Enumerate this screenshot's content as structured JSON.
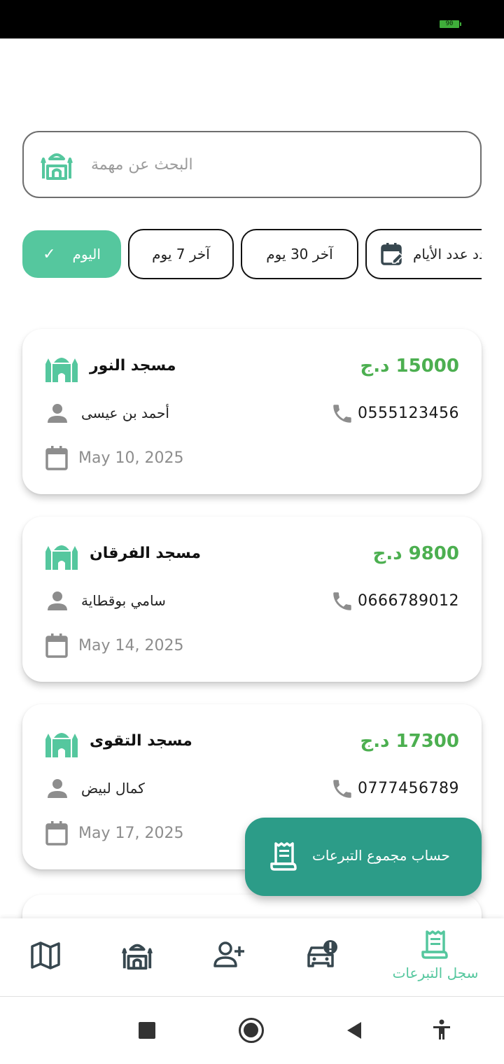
{
  "status_bar": {
    "battery": "90"
  },
  "search": {
    "placeholder": "البحث عن مهمة",
    "icon": "mosque-icon"
  },
  "filters": [
    {
      "label": "اليوم",
      "selected": true
    },
    {
      "label": "آخر 7 يوم",
      "selected": false
    },
    {
      "label": "آخر 30 يوم",
      "selected": false
    },
    {
      "label": "حدد عدد الأيام",
      "selected": false,
      "icon": "edit-calendar-icon"
    }
  ],
  "donations": [
    {
      "mosque": "مسجد النور",
      "amount": "15000 د.ج",
      "donor": "أحمد بن عيسى",
      "phone": "0555123456",
      "date": "May 10, 2025"
    },
    {
      "mosque": "مسجد الفرقان",
      "amount": "9800 د.ج",
      "donor": "سامي بوقطاية",
      "phone": "0666789012",
      "date": "May 14, 2025"
    },
    {
      "mosque": "مسجد التقوى",
      "amount": "17300 د.ج",
      "donor": "كمال لبيض",
      "phone": "0777456789",
      "date": "May 17, 2025"
    }
  ],
  "fab": {
    "label": "حساب مجموع التبرعات",
    "icon": "receipt-icon"
  },
  "bottom_nav": {
    "items": [
      {
        "icon": "map-icon"
      },
      {
        "icon": "mosque-icon"
      },
      {
        "icon": "person-add-icon"
      },
      {
        "icon": "car-alert-icon"
      },
      {
        "icon": "receipt-icon",
        "label": "سجل التبرعات",
        "active": true
      }
    ]
  },
  "colors": {
    "accent": "#55c79e",
    "fab": "#2c9c88",
    "amount": "#4caf50",
    "nav_icon": "#37474f"
  }
}
